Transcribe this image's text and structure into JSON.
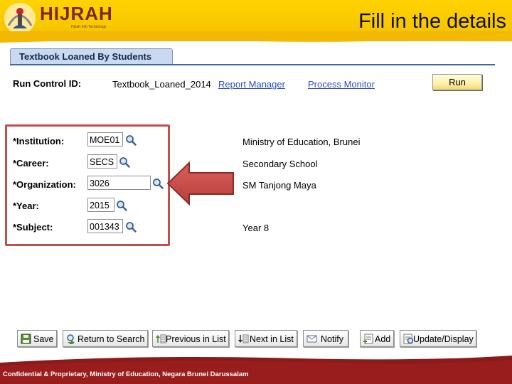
{
  "header": {
    "logo_text": "HIJRAH",
    "logo_tagline": "Hijrah Info Technology",
    "slide_title": "Fill in the details"
  },
  "page": {
    "tab_label": "Textbook Loaned By Students"
  },
  "run_control": {
    "label": "Run Control ID:",
    "value": "Textbook_Loaned_2014",
    "report_manager": "Report Manager",
    "process_monitor": "Process Monitor",
    "run_label": "Run"
  },
  "fields": {
    "institution": {
      "label": "*Institution:",
      "value": "MOE01",
      "description": "Ministry of Education, Brunei"
    },
    "career": {
      "label": "*Career:",
      "value": "SECS",
      "description": "Secondary School"
    },
    "organization": {
      "label": "*Organization:",
      "value": "3026",
      "description": "SM Tanjong Maya"
    },
    "year": {
      "label": "*Year:",
      "value": "2015",
      "description": ""
    },
    "subject": {
      "label": "*Subject:",
      "value": "001343",
      "description": "Year 8"
    }
  },
  "toolbar": {
    "save": "Save",
    "return_to_search": "Return to Search",
    "previous_in_list": "Previous in List",
    "next_in_list": "Next in List",
    "notify": "Notify",
    "add": "Add",
    "update_display": "Update/Display"
  },
  "footer": {
    "text": "Confidential & Proprietary, Ministry of Education, Negara Brunei Darussalam"
  },
  "colors": {
    "banner": "#ffd200",
    "highlight_box": "#c0504d",
    "link": "#2d4fb8",
    "footer": "#8b1a1a"
  },
  "icons": [
    "hijrah-emblem-icon",
    "lookup-magnifier-icon",
    "save-icon",
    "return-icon",
    "previous-icon",
    "next-icon",
    "notify-icon",
    "add-icon",
    "update-display-icon",
    "right-arrow-icon"
  ]
}
